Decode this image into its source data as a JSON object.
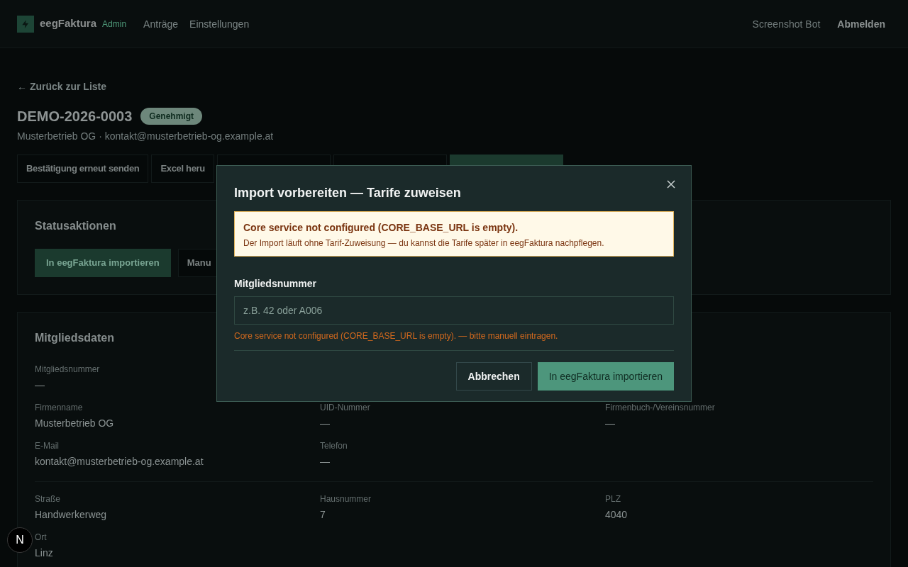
{
  "header": {
    "brand": "eegFaktura",
    "badge": "Admin",
    "nav": [
      "Anträge",
      "Einstellungen"
    ],
    "user": "Screenshot Bot",
    "logout": "Abmelden"
  },
  "back_link": "← Zurück zur Liste",
  "title": "DEMO-2026-0003",
  "status": "Genehmigt",
  "subtitle": "Musterbetrieb OG · kontakt@musterbetrieb-og.example.at",
  "actions": [
    {
      "label": "Bestätigung erneut senden",
      "kind": "secondary"
    },
    {
      "label": "Excel heru",
      "kind": "secondary"
    },
    {
      "kind": "secondary"
    },
    {
      "kind": "secondary"
    },
    {
      "kind": "primary"
    }
  ],
  "status_card": {
    "title": "Statusaktionen",
    "buttons": [
      {
        "label": "In eegFaktura importieren",
        "kind": "primary"
      },
      {
        "label": "Manu",
        "kind": "secondary"
      }
    ]
  },
  "member_card": {
    "title": "Mitgliedsdaten",
    "groups": [
      [
        [
          {
            "label": "Mitgliedsnummer",
            "value": "—"
          }
        ],
        [
          {
            "label": "Firmenname",
            "value": "Musterbetrieb OG"
          },
          {
            "label": "UID-Nummer",
            "value": "—"
          },
          {
            "label": "Firmenbuch-/Vereinsnummer",
            "value": "—"
          }
        ],
        [
          {
            "label": "E-Mail",
            "value": "kontakt@musterbetrieb-og.example.at"
          },
          {
            "label": "Telefon",
            "value": "—"
          }
        ]
      ],
      [
        [
          {
            "label": "Straße",
            "value": "Handwerkerweg"
          },
          {
            "label": "Hausnummer",
            "value": "7"
          },
          {
            "label": "PLZ",
            "value": "4040"
          }
        ],
        [
          {
            "label": "Ort",
            "value": "Linz"
          }
        ]
      ]
    ]
  },
  "modal": {
    "title": "Import vorbereiten — Tarife zuweisen",
    "alert": {
      "title": "Core service not configured (CORE_BASE_URL is empty).",
      "text": "Der Import läuft ohne Tarif-Zuweisung — du kannst die Tarife später in eegFaktura nachpflegen."
    },
    "field": {
      "label": "Mitgliedsnummer",
      "placeholder": "z.B. 42 oder A006",
      "error": "Core service not configured (CORE_BASE_URL is empty). — bitte manuell eintragen."
    },
    "buttons": [
      {
        "label": "Abbrechen",
        "kind": "secondary"
      },
      {
        "label": "In eegFaktura importieren",
        "kind": "primary"
      }
    ]
  },
  "dev_badge": "N"
}
